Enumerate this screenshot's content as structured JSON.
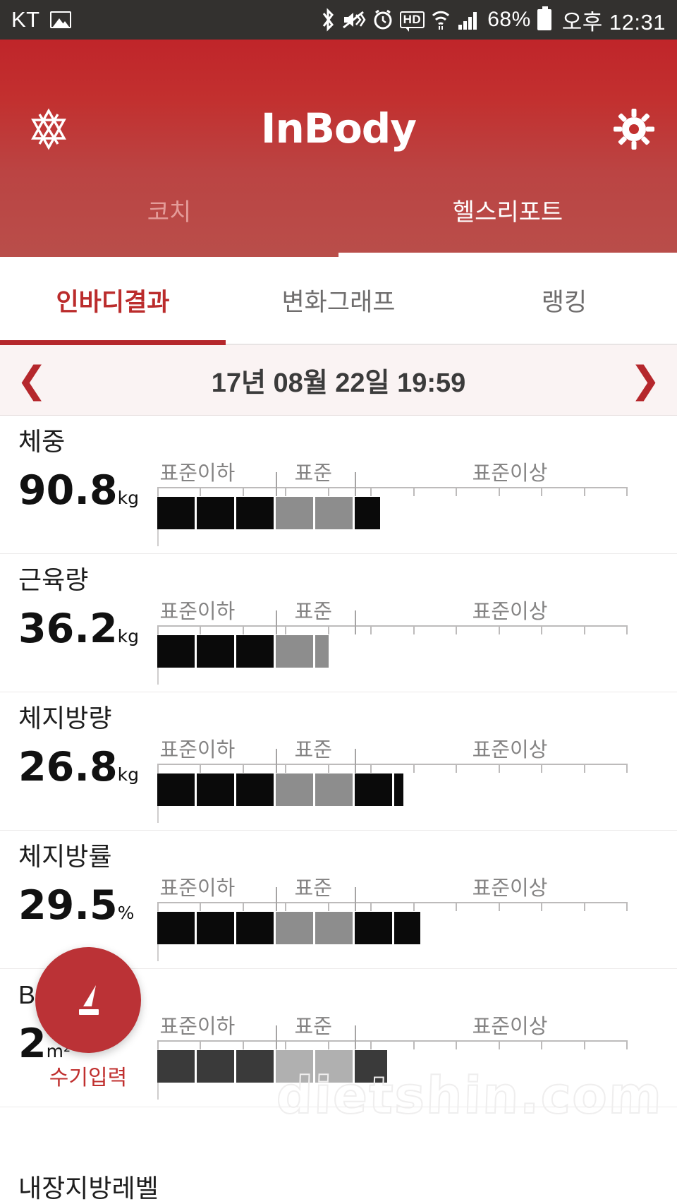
{
  "statusbar": {
    "carrier": "KT",
    "icons": [
      "image-icon",
      "bluetooth-icon",
      "mute-vibrate-icon",
      "alarm-icon",
      "hd-icon",
      "wifi-icon",
      "signal-icon"
    ],
    "hd_label": "HD",
    "battery_percent": "68%",
    "time": "오후 12:31"
  },
  "header": {
    "title": "InBody",
    "logo_icon": "inbody-logo-icon",
    "settings_icon": "gear-icon"
  },
  "top_tabs": [
    {
      "label": "코치",
      "active": false
    },
    {
      "label": "헬스리포트",
      "active": true
    }
  ],
  "sub_tabs": [
    {
      "label": "인바디결과",
      "active": true
    },
    {
      "label": "변화그래프",
      "active": false
    },
    {
      "label": "랭킹",
      "active": false
    }
  ],
  "date_nav": {
    "prev_icon": "chevron-left-icon",
    "next_icon": "chevron-right-icon",
    "date": "17년 08월 22일 19:59"
  },
  "zone_labels": {
    "below": "표준이하",
    "normal": "표준",
    "above": "표준이상"
  },
  "metrics": [
    {
      "label": "체중",
      "value": "90.8",
      "unit": "kg",
      "fill_percent": 48.0
    },
    {
      "label": "근육량",
      "value": "36.2",
      "unit": "kg",
      "fill_percent": 37.0
    },
    {
      "label": "체지방량",
      "value": "26.8",
      "unit": "kg",
      "fill_percent": 53.0
    },
    {
      "label": "체지방률",
      "value": "29.5",
      "unit": "%",
      "fill_percent": 56.5
    },
    {
      "label": "BMI",
      "value": "2",
      "unit": "m²",
      "fill_percent": 49.5
    }
  ],
  "fab": {
    "icon": "pencil-icon",
    "label": "수기입력"
  },
  "bottom_metric_label": "내장지방레벨",
  "watermark": "dietshin.com",
  "colors": {
    "brand_red": "#bb2c2c",
    "header_red": "#c0252a",
    "bar_black": "#0a0a0a",
    "bar_gray": "#8d8d8d",
    "status_bg": "#33312f"
  }
}
